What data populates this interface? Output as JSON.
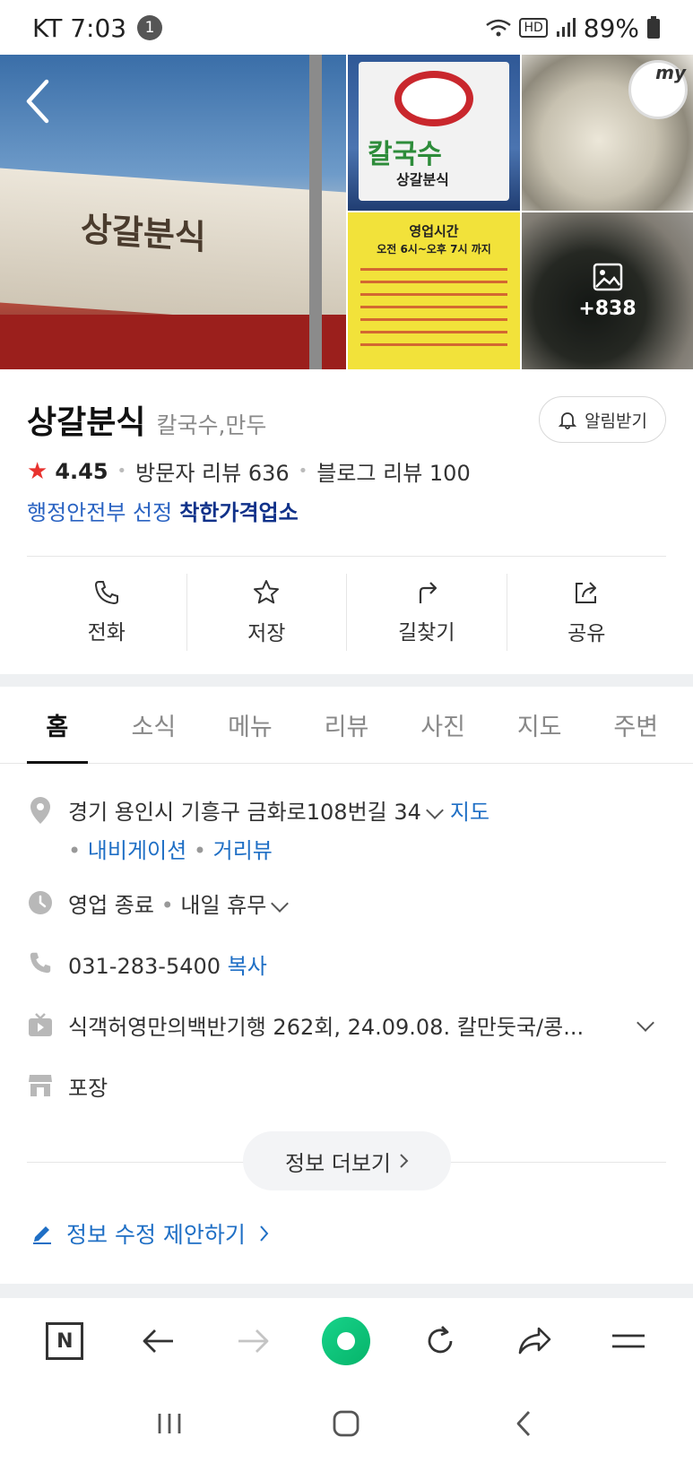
{
  "status_bar": {
    "carrier_time": "KT 7:03",
    "notification_count": "1",
    "hd": "HD",
    "battery": "89%"
  },
  "photos": {
    "main_sign_text": "상갈분식",
    "sign2_brand": "칼국수",
    "sign2_sub": "상갈분식",
    "hours_title": "영업시간",
    "hours_time": "오전 6시~오후 7시 까지",
    "my_badge": "my",
    "more_count": "+838",
    "icons": {
      "back": "chevron-left-icon",
      "gallery": "image-icon"
    }
  },
  "place": {
    "name": "상갈분식",
    "category": "칼국수,만두",
    "alarm_label": "알림받기",
    "rating": "4.45",
    "visitor_reviews": "방문자 리뷰 636",
    "blog_reviews": "블로그 리뷰 100",
    "gov_prefix": "행정안전부 선정",
    "gov_badge": "착한가격업소",
    "accent_color": "#1f6fc5",
    "star_color": "#e8322e"
  },
  "actions": [
    {
      "label": "전화",
      "icon": "phone-icon"
    },
    {
      "label": "저장",
      "icon": "star-icon"
    },
    {
      "label": "길찾기",
      "icon": "directions-icon"
    },
    {
      "label": "공유",
      "icon": "share-icon"
    }
  ],
  "tabs": [
    {
      "label": "홈",
      "active": true
    },
    {
      "label": "소식"
    },
    {
      "label": "메뉴"
    },
    {
      "label": "리뷰"
    },
    {
      "label": "사진"
    },
    {
      "label": "지도"
    },
    {
      "label": "주변"
    }
  ],
  "details": {
    "address": "경기 용인시 기흥구 금화로108번길 34",
    "map_link": "지도",
    "navigation_link": "내비게이션",
    "street_view_link": "거리뷰",
    "status": "영업 종료",
    "status_next": "내일 휴무",
    "phone": "031-283-5400",
    "copy_link": "복사",
    "tv": "식객허영만의백반기행 262회, 24.09.08. 칼만둣국/콩...",
    "service": "포장"
  },
  "more_info": "정보 더보기",
  "edit_suggestion": "정보 수정 제안하기",
  "browser_bar": {
    "naver_label": "N"
  }
}
